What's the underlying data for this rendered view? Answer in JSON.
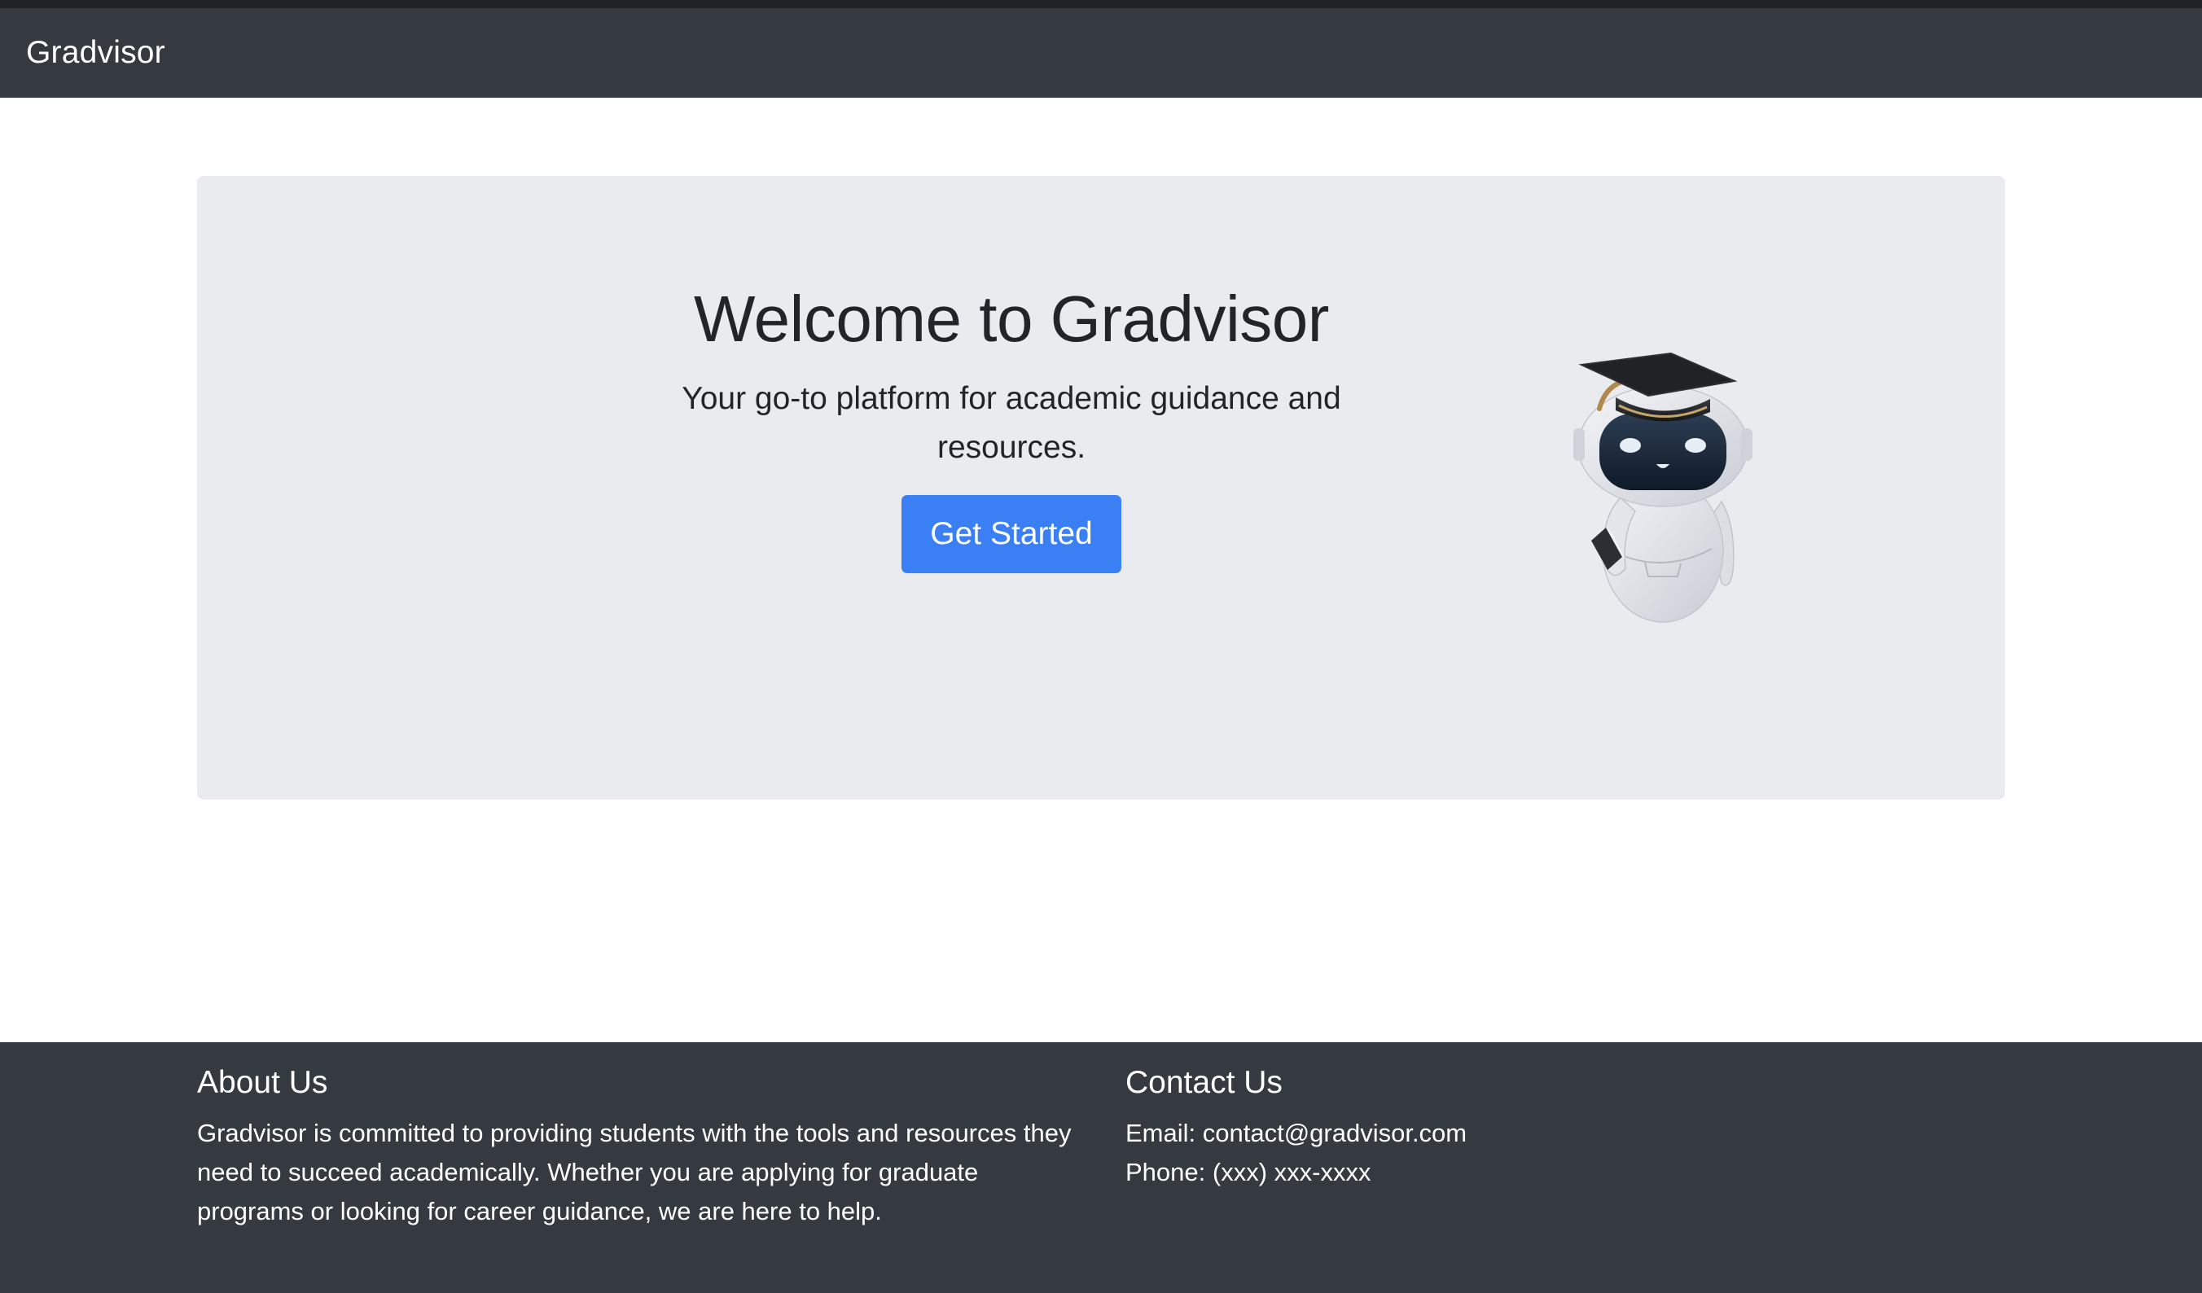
{
  "navbar": {
    "brand": "Gradvisor"
  },
  "hero": {
    "title": "Welcome to Gradvisor",
    "subtitle": "Your go-to platform for academic guidance and resources.",
    "cta_label": "Get Started",
    "mascot_icon": "graduation-robot-icon"
  },
  "footer": {
    "about": {
      "heading": "About Us",
      "text": "Gradvisor is committed to providing students with the tools and resources they need to succeed academically. Whether you are applying for graduate programs or looking for career guidance, we are here to help."
    },
    "contact": {
      "heading": "Contact Us",
      "email": "Email: contact@gradvisor.com",
      "phone": "Phone: (xxx) xxx-xxxx"
    }
  },
  "colors": {
    "navbar_bg": "#343a40",
    "hero_bg": "#e9ebef",
    "button_bg": "#3b7ff5",
    "footer_bg": "#343a40"
  }
}
